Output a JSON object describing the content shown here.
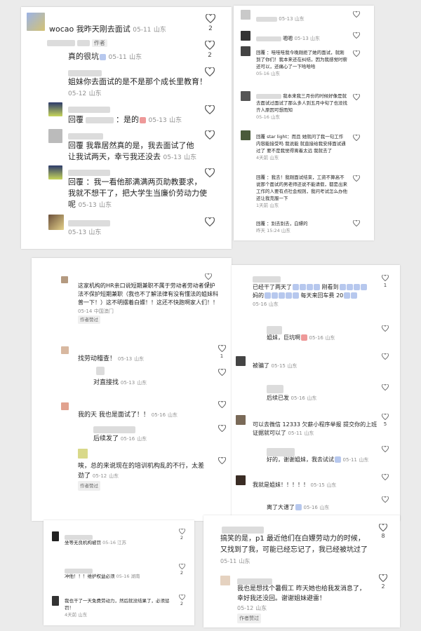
{
  "panel1_left": [
    {
      "text": "wocao 我昨天刚去面试",
      "date": "05-11",
      "loc": "山东",
      "likes": "2"
    },
    {
      "prefix": "真的很坑",
      "author_tag": "作者",
      "date": "05-11",
      "loc": "山东",
      "likes": "2"
    },
    {
      "text": "姐妹你去面试的是不是那个成长里教育！",
      "date": "05-12",
      "loc": "山东",
      "likes": ""
    },
    {
      "text": "：是的",
      "date": "05-13",
      "loc": "山东",
      "likes": ""
    },
    {
      "text": "回覆   我靠居然真的是，我去面试了他让我试两天，幸亏我还没去",
      "date": "05-13",
      "loc": "山东",
      "likes": ""
    },
    {
      "text": "回覆   ：我一看他那满满两页助教要求，我就不想干了，把大学生当廉价劳动力使呢",
      "date": "05-13",
      "loc": "山东",
      "likes": ""
    },
    {
      "text": "",
      "date": "05-13",
      "loc": "山东",
      "likes": ""
    }
  ],
  "panel1_right": [
    {
      "text": "",
      "date": "05-13",
      "loc": "山东"
    },
    {
      "text": "嗯嗯",
      "date": "05-13",
      "loc": "山东"
    },
    {
      "text": "回覆  ：哇哇哇我今晚刚拒了她的面试，就刚到了你们！我本来还在纠结，因为我感觉时薪还可以，还痛心了一下哈哈哈",
      "date": "05-16",
      "loc": "山东"
    },
    {
      "text": "我本来我三月份的时候好像是就去面试过面试了那么多人到五月中旬了也没找齐人原因可想而知",
      "date": "05-16",
      "loc": "山东"
    },
    {
      "text": "回覆 star light：而且 她就问了我一句工作内容能接受吗 我说能 就直接给我安排面试通过了 要不是我觉得离着太远 我就去了",
      "date": "4天前",
      "loc": "山东"
    },
    {
      "text": "回覆   ：我去！我刚面试结束，工资不算高不说那个面试的男老师还说不能请假，都是出来工作的人要有点社会规则，我问考试怎么办他还让我克服一下",
      "date": "1天前",
      "loc": "山东"
    },
    {
      "text": "回覆   ：别去别去，白嫖的",
      "date": "昨天 15:24",
      "loc": "山东"
    }
  ],
  "panel2_left": [
    {
      "text": "这家机构的HR亲口说短期兼职不属于劳动者劳动者保护法不保护短期兼职（我也不了解法律有没有懂法的姐妹科普一下！）这不明摆着白嫖！！这还不快跑啊家人们！！",
      "date": "05-14",
      "loc": "中国澳门",
      "author_tag": "作者赞过",
      "likes": "1"
    },
    {
      "text": "找劳动稽查！",
      "date": "05-13",
      "loc": "山东",
      "likes": "1"
    },
    {
      "text": "对直接找",
      "date": "05-13",
      "loc": "山东",
      "likes": ""
    },
    {
      "text": "我的天 我也是面试了！！",
      "date": "05-16",
      "loc": "山东",
      "likes": ""
    },
    {
      "text": "后续发了",
      "date": "05-16",
      "loc": "山东",
      "likes": ""
    },
    {
      "text": "唉，总的来说现在的培训机构乱的不行，太差劲了",
      "date": "05-12",
      "loc": "山东",
      "author_tag": "作者赞过",
      "likes": ""
    }
  ],
  "panel2_right": [
    {
      "text": "已经干了两天了",
      "text2": "刚看到",
      "text3": "妈的",
      "text4": "每天来回车费 20",
      "date": "05-16",
      "loc": "山东",
      "likes": "1"
    },
    {
      "text": "姐妹，巨坑啊",
      "date": "05-16",
      "loc": "山东",
      "likes": ""
    },
    {
      "text": "被骗了",
      "date": "05-15",
      "loc": "山东",
      "likes": ""
    },
    {
      "text": "后续已发",
      "date": "05-16",
      "loc": "山东",
      "likes": ""
    },
    {
      "text": "可以去微信 12333 欠薪小程序举报 提交你的上班证据就可以了",
      "date": "05-11",
      "loc": "山东",
      "likes": "5"
    },
    {
      "text": "好的，谢谢姐妹，我去试试",
      "date": "05-11",
      "loc": "山东",
      "likes": ""
    },
    {
      "text": "我就是姐妹！！！！！",
      "date": "05-15",
      "loc": "山东",
      "likes": ""
    },
    {
      "text": "离了大谱了",
      "date": "05-16",
      "loc": "山东",
      "likes": ""
    }
  ],
  "panel3_left": [
    {
      "text": "坐等无良机构被罚",
      "date": "05-16",
      "loc": "江苏",
      "likes": "2"
    },
    {
      "text": "冲他！！！维护权益必须",
      "date": "05-16",
      "loc": "湖南",
      "likes": "2"
    },
    {
      "text": "我也干了一天免费劳动力，然后就没结果了，必须惩罚！",
      "date": "4天前",
      "loc": "山东",
      "likes": "2"
    }
  ],
  "panel3_right": [
    {
      "text": "搞笑的是，p1 最近他们在白嫖劳动力的时候，又找到了我，可能已经忘记了，我已经被坑过了",
      "date": "05-11",
      "loc": "山东",
      "likes": "8"
    },
    {
      "text": "我也是想找个暑假工 昨天她也给我发消息了，幸好我还没回。谢谢姐妹避雷！",
      "date": "05-12",
      "loc": "山东",
      "author_tag": "作者赞过",
      "likes": "2"
    }
  ],
  "colors": {
    "heart": "#555555",
    "meta": "#8f8f8f",
    "emoji": "#b7c8ee"
  }
}
